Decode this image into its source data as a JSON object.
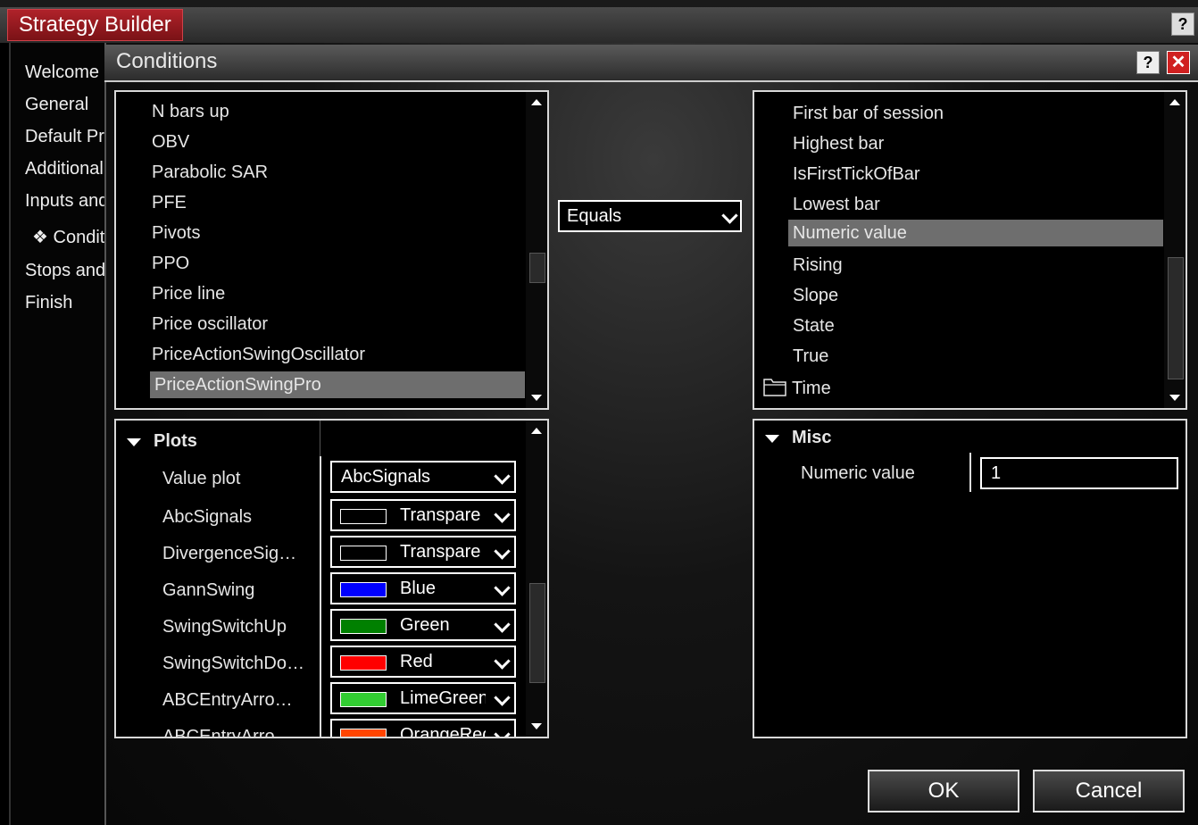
{
  "background_window": {
    "title": "Strategy Builder",
    "help_label": "?",
    "nav": [
      "Welcome",
      "General",
      "Default Pr",
      "Additional",
      "Inputs and",
      "Condit",
      "Stops and",
      "Finish"
    ],
    "nav_current_prefix": "❖"
  },
  "dialog": {
    "title": "Conditions",
    "help_label": "?",
    "close_label": "✕",
    "left_list": {
      "items": [
        "N bars up",
        "OBV",
        "Parabolic SAR",
        "PFE",
        "Pivots",
        "PPO",
        "Price line",
        "Price oscillator",
        "PriceActionSwingOscillator",
        "PriceActionSwingPro"
      ],
      "selected": "PriceActionSwingPro"
    },
    "operator": {
      "value": "Equals"
    },
    "right_list": {
      "items": [
        "First bar of session",
        "Highest bar",
        "IsFirstTickOfBar",
        "Lowest bar",
        "Numeric value",
        "Rising",
        "Slope",
        "State",
        "True",
        "Time"
      ],
      "selected": "Numeric value",
      "folder_item": "Time"
    },
    "plots": {
      "header": "Plots",
      "rows": [
        {
          "label": "Value plot",
          "value": "AbcSignals",
          "color": null
        },
        {
          "label": "AbcSignals",
          "value": "Transpare",
          "color": "#000000"
        },
        {
          "label": "DivergenceSig…",
          "value": "Transpare",
          "color": "#000000"
        },
        {
          "label": "GannSwing",
          "value": "Blue",
          "color": "#0000ff"
        },
        {
          "label": "SwingSwitchUp",
          "value": "Green",
          "color": "#008000"
        },
        {
          "label": "SwingSwitchDo…",
          "value": "Red",
          "color": "#ff0000"
        },
        {
          "label": "ABCEntryArro…",
          "value": "LimeGreen",
          "color": "#32cd32"
        },
        {
          "label": "ABCEntryArro…",
          "value": "OrangeRed",
          "color": "#ff4500"
        }
      ]
    },
    "misc": {
      "header": "Misc",
      "label": "Numeric value",
      "value": "1"
    },
    "ok_label": "OK",
    "cancel_label": "Cancel"
  }
}
